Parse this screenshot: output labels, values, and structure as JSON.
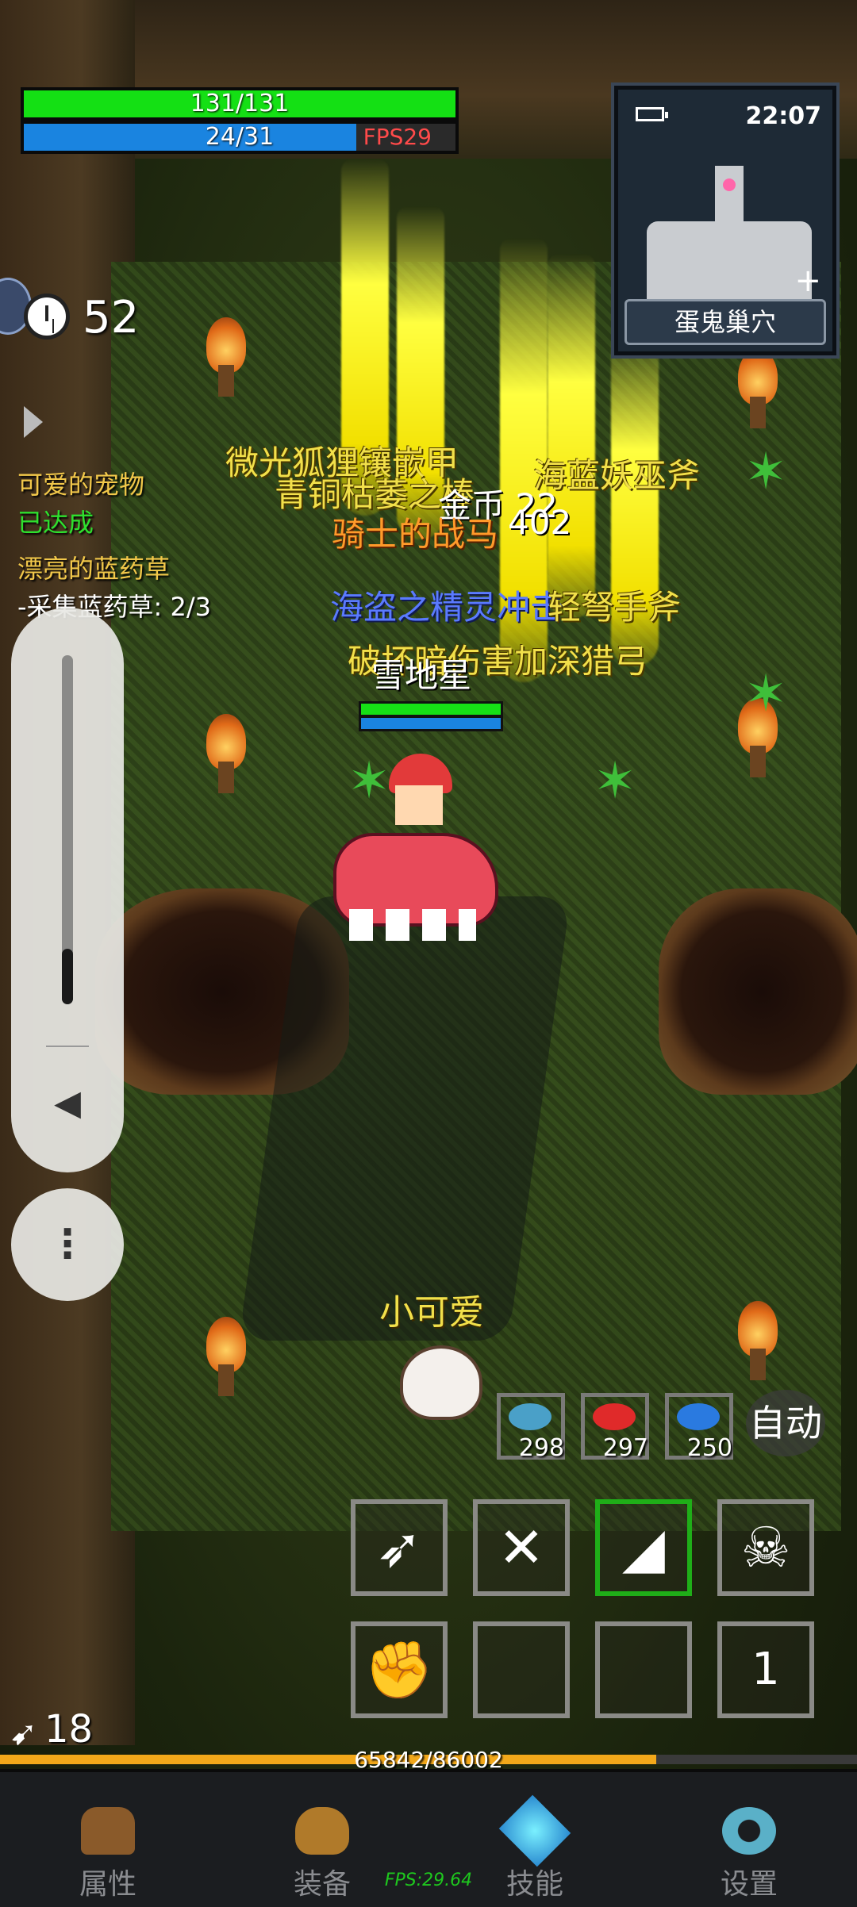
{
  "hud": {
    "hp": "131/131",
    "hp_fraction": 1.0,
    "mp": "24/31",
    "mp_fraction": 0.77,
    "fps_label": "FPS29",
    "timer": "52"
  },
  "minimap": {
    "clock": "22:07",
    "location": "蛋鬼巢穴",
    "zoom_icon": "plus-icon",
    "battery_icon": "battery-icon"
  },
  "quests": [
    {
      "text": "可爱的宠物",
      "color": "#f2c84a"
    },
    {
      "text": "已达成",
      "color": "#2ee02e"
    },
    {
      "text": "漂亮的蓝药草",
      "color": "#f2c84a"
    },
    {
      "text": "-采集蓝药草: 2/3",
      "color": "#ffffff"
    }
  ],
  "floating_labels": {
    "l1": "微光狐狸镶嵌甲",
    "l2": "青铜枯萎之棒",
    "l3": "金币 22",
    "l4": "海蓝妖巫斧",
    "l5": "骑士的战马",
    "l6": "402",
    "l7": "海盗之精灵冲击",
    "l8": "轻弩手斧",
    "l9": "破坏暗伤害加深猎弓",
    "player_name": "雪地星",
    "pet_name": "小可爱"
  },
  "potions": [
    {
      "icon": "fish-icon",
      "count": "298",
      "color": "#4aa0c8"
    },
    {
      "icon": "meat-icon",
      "count": "297",
      "color": "#e02a2a"
    },
    {
      "icon": "mana-fish-icon",
      "count": "250",
      "color": "#2a7ae0"
    }
  ],
  "auto_label": "自动",
  "skills": {
    "page_number": "1"
  },
  "attack": "18",
  "xp": {
    "text": "65842/86002",
    "fraction": 0.7655
  },
  "nav": {
    "attributes": "属性",
    "equipment": "装备",
    "skills": "技能",
    "settings": "设置"
  },
  "footer_fps": "FPS:29.64"
}
